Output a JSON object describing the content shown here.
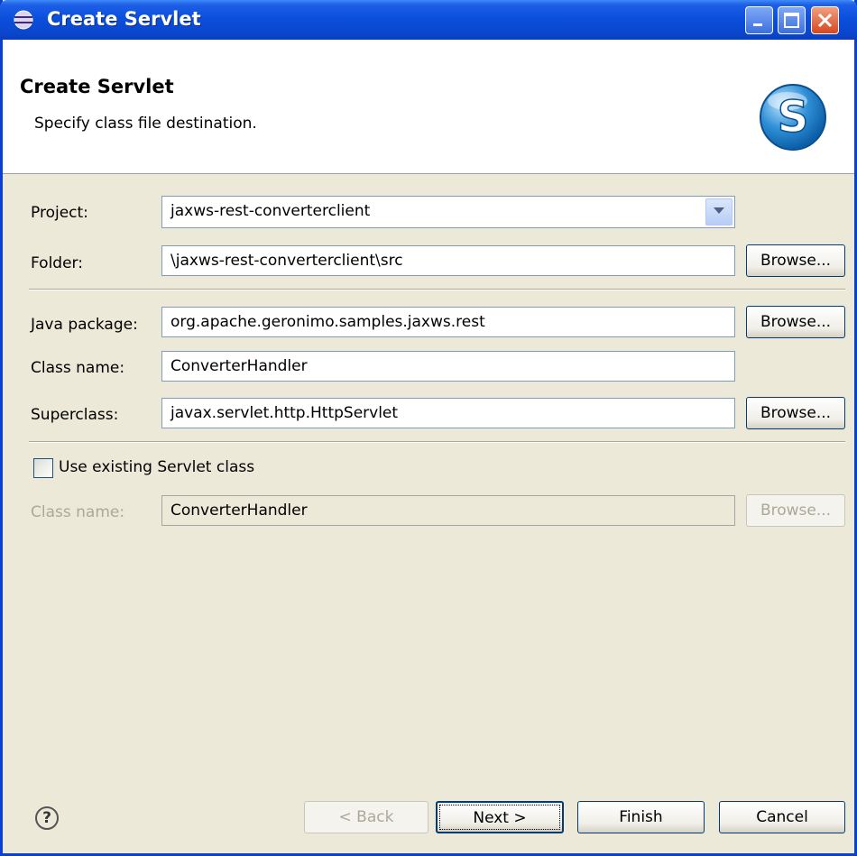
{
  "window": {
    "title": "Create Servlet"
  },
  "header": {
    "title": "Create Servlet",
    "description": "Specify class file destination.",
    "logo_letter": "S"
  },
  "form": {
    "project": {
      "label": "Project:",
      "value": "jaxws-rest-converterclient"
    },
    "folder": {
      "label": "Folder:",
      "value": "\\jaxws-rest-converterclient\\src",
      "browse": "Browse..."
    },
    "java_package": {
      "label": "Java package:",
      "value": "org.apache.geronimo.samples.jaxws.rest",
      "browse": "Browse..."
    },
    "class_name": {
      "label": "Class name:",
      "value": "ConverterHandler"
    },
    "superclass": {
      "label": "Superclass:",
      "value": "javax.servlet.http.HttpServlet",
      "browse": "Browse..."
    },
    "use_existing": {
      "label": "Use existing Servlet class",
      "checked": false
    },
    "existing_class": {
      "label": "Class name:",
      "value": "ConverterHandler",
      "browse": "Browse..."
    }
  },
  "footer": {
    "help": "?",
    "back": "< Back",
    "next": "Next >",
    "finish": "Finish",
    "cancel": "Cancel"
  },
  "colors": {
    "titlebar": "#0a47cf",
    "dialog_bg": "#ece9d8",
    "field_border": "#7f9db9",
    "disabled_text": "#aca899"
  }
}
